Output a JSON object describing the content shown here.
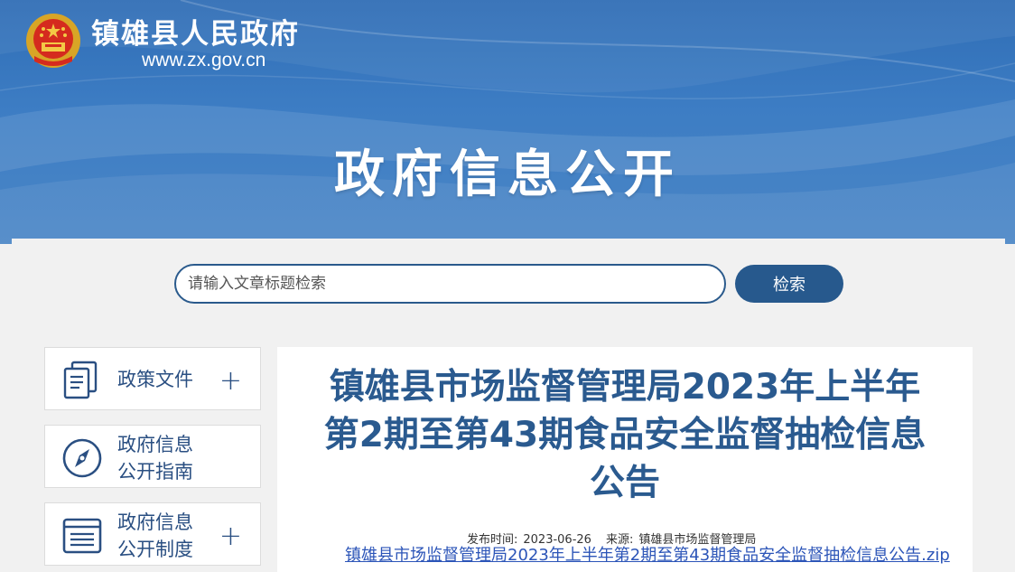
{
  "header": {
    "site_name": "镇雄县人民政府",
    "site_url": "www.zx.gov.cn",
    "section_title": "政府信息公开"
  },
  "search": {
    "placeholder": "请输入文章标题检索",
    "button_label": "检索"
  },
  "sidebar": {
    "items": [
      {
        "label_line1": "政策文件",
        "label_line2": "",
        "icon": "document-icon",
        "expandable": true
      },
      {
        "label_line1": "政府信息",
        "label_line2": "公开指南",
        "icon": "compass-icon",
        "expandable": false
      },
      {
        "label_line1": "政府信息",
        "label_line2": "公开制度",
        "icon": "list-icon",
        "expandable": true
      }
    ]
  },
  "article": {
    "title_line1": "镇雄县市场监督管理局2023年上半年",
    "title_line2": "第2期至第43期食品安全监督抽检信息",
    "title_line3": "公告",
    "publish_label": "发布时间:",
    "publish_date": "2023-06-26",
    "source_label": "来源:",
    "source": "镇雄县市场监督管理局",
    "attachment": "镇雄县市场监督管理局2023年上半年第2期至第43期食品安全监督抽检信息公告.zip"
  },
  "colors": {
    "banner": "#3d7dc4",
    "accent": "#27598d",
    "title": "#2a5a8f",
    "link": "#2c55b8"
  }
}
